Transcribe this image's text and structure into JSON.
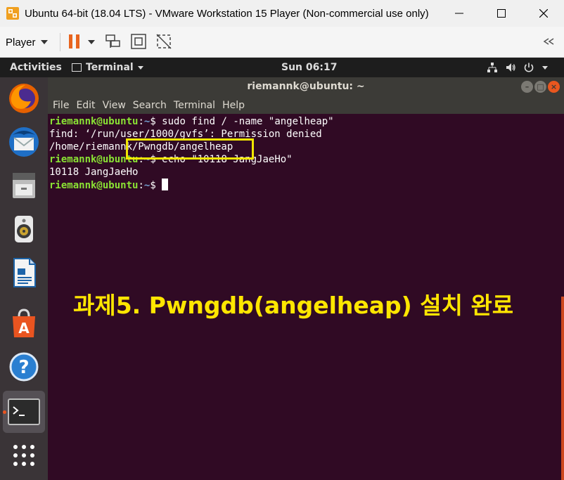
{
  "window": {
    "title": "Ubuntu 64-bit (18.04 LTS) - VMware Workstation 15 Player (Non-commercial use only)"
  },
  "toolbar": {
    "player_label": "Player",
    "icons": [
      "pause-icon",
      "dropdown-caret-icon",
      "send-ctrl-alt-del-icon",
      "fit-guest-icon",
      "unity-mode-icon",
      "collapse-toolbar-icon"
    ]
  },
  "topbar": {
    "activities": "Activities",
    "app_name": "Terminal",
    "clock": "Sun 06:17",
    "icons": [
      "network-icon",
      "volume-icon",
      "power-icon",
      "chevron-down-icon"
    ]
  },
  "dock": {
    "items": [
      {
        "name": "firefox",
        "icon": "firefox-icon"
      },
      {
        "name": "thunderbird",
        "icon": "thunderbird-icon"
      },
      {
        "name": "files",
        "icon": "files-icon"
      },
      {
        "name": "rhythmbox",
        "icon": "speaker-icon"
      },
      {
        "name": "libreoffice-writer",
        "icon": "writer-icon"
      },
      {
        "name": "ubuntu-software",
        "icon": "software-bag-icon"
      },
      {
        "name": "help",
        "icon": "help-icon"
      },
      {
        "name": "terminal",
        "icon": "terminal-icon",
        "active": true
      },
      {
        "name": "show-applications",
        "icon": "app-grid-icon"
      }
    ]
  },
  "terminal": {
    "title": "riemannk@ubuntu: ~",
    "menu": [
      "File",
      "Edit",
      "View",
      "Search",
      "Terminal",
      "Help"
    ],
    "prompt": {
      "user": "riemannk@ubuntu",
      "sep": ":",
      "path": "~",
      "symbol": "$ "
    },
    "lines": [
      {
        "type": "cmd",
        "text": "sudo find / -name \"angelheap\""
      },
      {
        "type": "out",
        "text": "find: ‘/run/user/1000/gvfs’: Permission denied"
      },
      {
        "type": "out",
        "text": "/home/riemannk/Pwngdb/angelheap"
      },
      {
        "type": "cmd",
        "text": "echo \"10118 JangJaeHo\""
      },
      {
        "type": "out",
        "text": "10118 JangJaeHo"
      },
      {
        "type": "cmd",
        "text": "",
        "cursor": true
      }
    ],
    "highlight_color": "#f2e600",
    "caption": "과제5. Pwngdb(angelheap) 설치 완료"
  },
  "colors": {
    "terminal_bg": "#300a24",
    "prompt_user": "#8ae234",
    "prompt_path": "#729fcf",
    "caption": "#ffe600",
    "ubuntu_orange": "#e95420"
  }
}
